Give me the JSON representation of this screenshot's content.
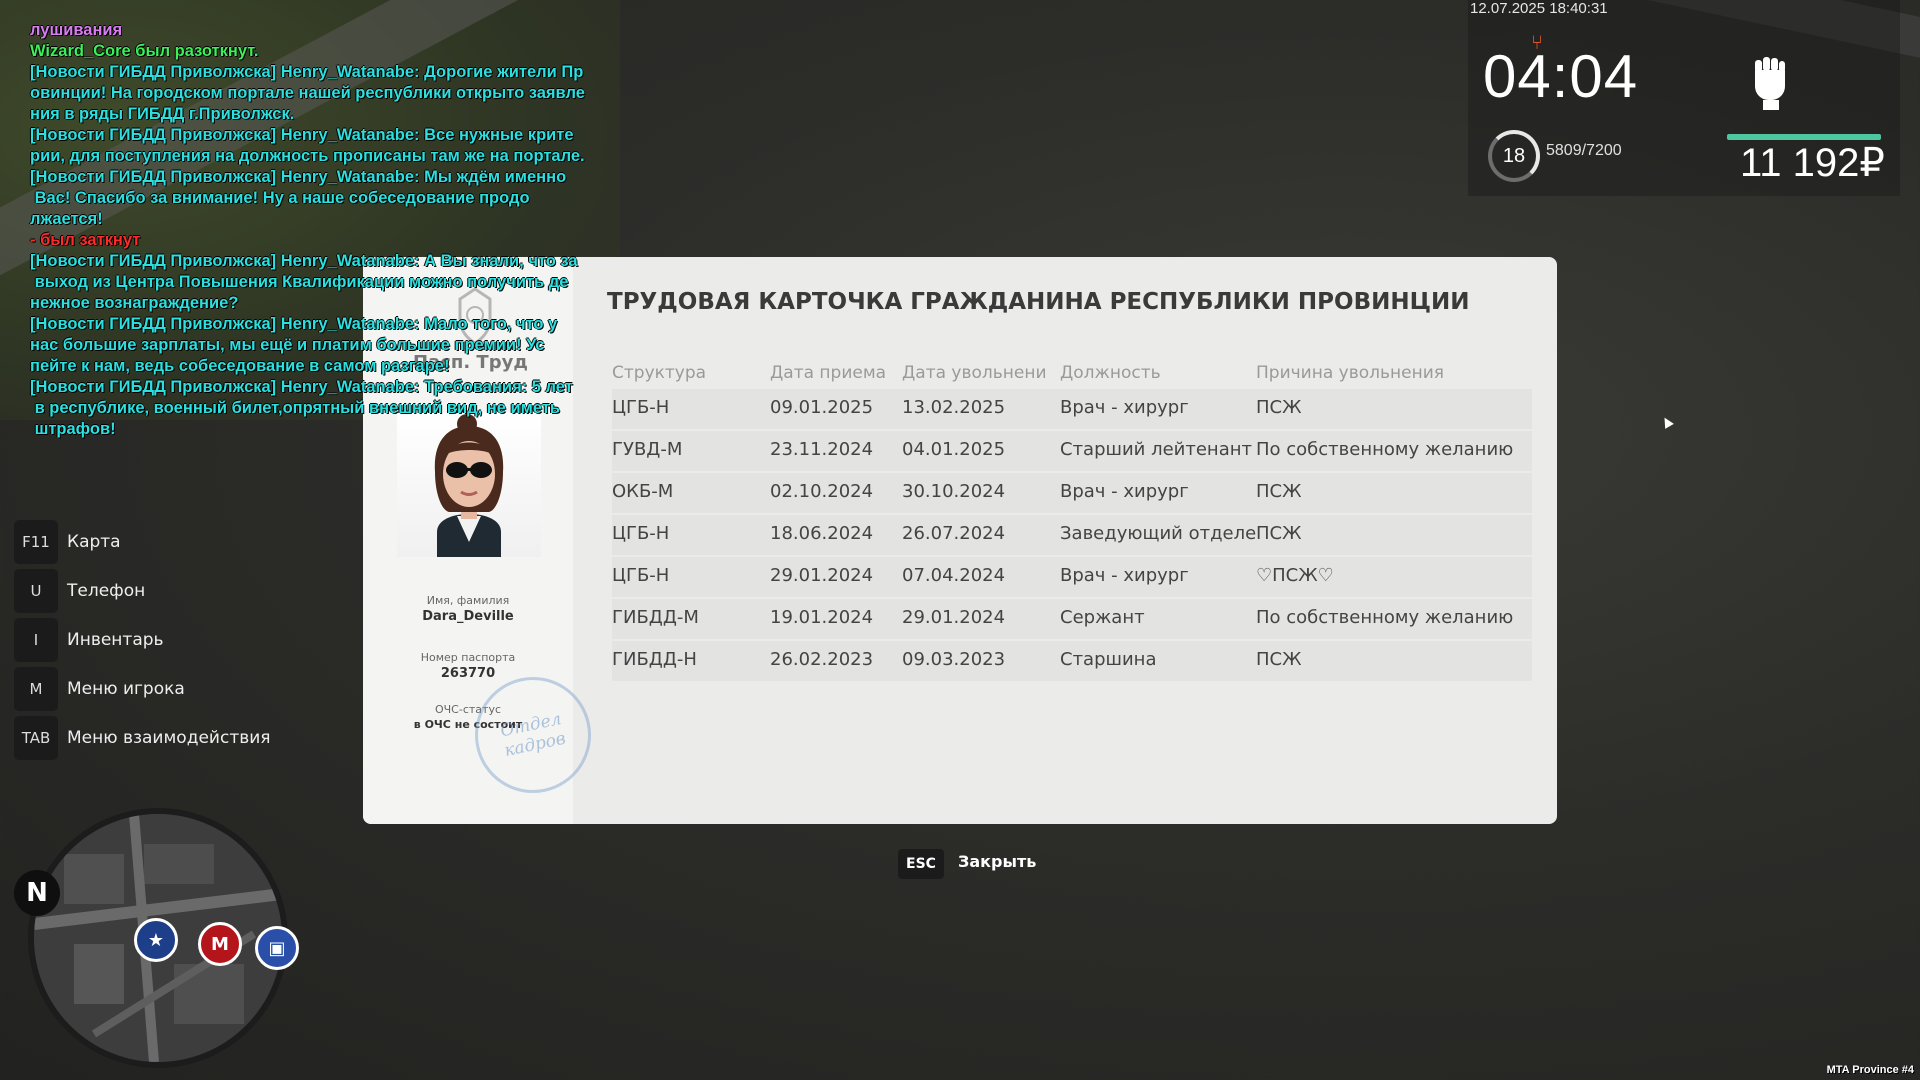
{
  "chat": [
    {
      "text": "лушивания",
      "color": "#d87df0"
    },
    {
      "text": "Wizard_Core был разоткнут.",
      "color": "#3cf05a"
    },
    {
      "text": "[Новости ГИБДД Приволжска] Henry_Watanabe: Дорогие жители Пр",
      "color": "#2de0e0"
    },
    {
      "text": "овинции! На городском портале нашей республики открыто заявле",
      "color": "#2de0e0"
    },
    {
      "text": "ния в ряды ГИБДД г.Приволжск.",
      "color": "#2de0e0"
    },
    {
      "text": "[Новости ГИБДД Приволжска] Henry_Watanabe: Все нужные крите",
      "color": "#2de0e0"
    },
    {
      "text": "рии, для поступления на должность прописаны там же на портале.",
      "color": "#2de0e0"
    },
    {
      "text": "[Новости ГИБДД Приволжска] Henry_Watanabe: Мы ждём именно",
      "color": "#2de0e0"
    },
    {
      "text": " Вас! Спасибо за внимание! Ну а наше собеседование продо",
      "color": "#2de0e0"
    },
    {
      "text": "лжается!",
      "color": "#2de0e0"
    },
    {
      "text": "- был заткнут",
      "color": "#ff2a2a"
    },
    {
      "text": "[Новости ГИБДД Приволжска] Henry_Watanabe: А Вы знали, что за",
      "color": "#2de0e0"
    },
    {
      "text": " выход из Центра Повышения Квалификации можно получить де",
      "color": "#2de0e0"
    },
    {
      "text": "нежное вознаграждение?",
      "color": "#2de0e0"
    },
    {
      "text": "[Новости ГИБДД Приволжска] Henry_Watanabe: Мало того, что у",
      "color": "#2de0e0"
    },
    {
      "text": "нас большие зарплаты, мы ещё и платим большие премии! Ус",
      "color": "#2de0e0"
    },
    {
      "text": "пейте к нам, ведь собеседование в самом разгаре!",
      "color": "#2de0e0"
    },
    {
      "text": "[Новости ГИБДД Приволжска] Henry_Watanabe: Требования: 5 лет",
      "color": "#2de0e0"
    },
    {
      "text": " в республике, военный билет,опрятный внешний вид, не иметь",
      "color": "#2de0e0"
    },
    {
      "text": " штрафов!",
      "color": "#2de0e0"
    }
  ],
  "hud": {
    "datetime": "12.07.2025 18:40:31",
    "time": "04:04",
    "hunger_icon": "fork-knife-icon",
    "level": "18",
    "xp": "5809/7200",
    "weapon_icon": "fist-icon",
    "health": 1.0,
    "money": "11 192₽"
  },
  "card": {
    "title": "ТРУДОВАЯ КАРТОЧКА ГРАЖДАНИНА РЕСПУБЛИКИ ПРОВИНЦИИ",
    "passport_title": "Пасп. Труд",
    "name_label": "Имя, фамилия",
    "name_value": "Dara_Deville",
    "passport_label": "Номер паспорта",
    "passport_value": "263770",
    "ochs_label": "ОЧС-статус",
    "ochs_value": "в ОЧС не состоит",
    "stamp_line1": "Отдел",
    "stamp_line2": "кадров",
    "columns": [
      "Структура",
      "Дата приема",
      "Дата увольнени",
      "Должность",
      "Причина увольнения"
    ],
    "rows": [
      [
        "ЦГБ-Н",
        "09.01.2025",
        "13.02.2025",
        "Врач - хирург",
        "ПСЖ"
      ],
      [
        "ГУВД-М",
        "23.11.2024",
        "04.01.2025",
        "Старший лейтенант",
        "По собственному желанию"
      ],
      [
        "ОКБ-М",
        "02.10.2024",
        "30.10.2024",
        "Врач - хирург",
        "ПСЖ"
      ],
      [
        "ЦГБ-Н",
        "18.06.2024",
        "26.07.2024",
        "Заведующий отделе",
        "ПСЖ"
      ],
      [
        "ЦГБ-Н",
        "29.01.2024",
        "07.04.2024",
        "Врач - хирург",
        "♡ПСЖ♡"
      ],
      [
        "ГИБДД-М",
        "19.01.2024",
        "29.01.2024",
        "Сержант",
        "По собственному желанию"
      ],
      [
        "ГИБДД-Н",
        "26.02.2023",
        "09.03.2023",
        "Старшина",
        "ПСЖ"
      ]
    ]
  },
  "close": {
    "key": "ESC",
    "label": "Закрыть"
  },
  "hotkeys": [
    {
      "key": "F11",
      "label": "Карта"
    },
    {
      "key": "U",
      "label": "Телефон"
    },
    {
      "key": "I",
      "label": "Инвентарь"
    },
    {
      "key": "M",
      "label": "Меню игрока"
    },
    {
      "key": "TAB",
      "label": "Меню взаимодействия"
    }
  ],
  "minimap": {
    "north": "N",
    "markers": [
      "police-icon",
      "metro-icon",
      "bus-icon"
    ],
    "metro_letter": "M"
  },
  "server": "MTA Province #4"
}
